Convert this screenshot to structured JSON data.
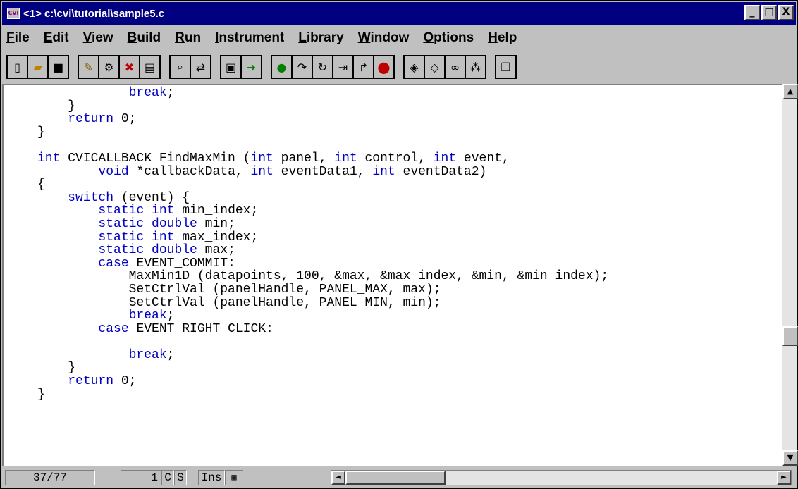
{
  "window": {
    "title": "<1> c:\\cvi\\tutorial\\sample5.c",
    "icon_text": "CVI",
    "minimize": "_",
    "maximize": "□",
    "close": "X"
  },
  "menu": [
    {
      "label": "File",
      "mnemonic": "F",
      "rest": "ile"
    },
    {
      "label": "Edit",
      "mnemonic": "E",
      "rest": "dit"
    },
    {
      "label": "View",
      "mnemonic": "V",
      "rest": "iew"
    },
    {
      "label": "Build",
      "mnemonic": "B",
      "rest": "uild"
    },
    {
      "label": "Run",
      "mnemonic": "R",
      "rest": "un"
    },
    {
      "label": "Instrument",
      "mnemonic": "I",
      "rest": "nstrument"
    },
    {
      "label": "Library",
      "mnemonic": "L",
      "rest": "ibrary"
    },
    {
      "label": "Window",
      "mnemonic": "W",
      "rest": "indow"
    },
    {
      "label": "Options",
      "mnemonic": "O",
      "rest": "ptions"
    },
    {
      "label": "Help",
      "mnemonic": "H",
      "rest": "elp"
    }
  ],
  "toolbar_icons": [
    "new-file-icon",
    "open-file-icon",
    "save-icon",
    "edit-icon",
    "tools-icon",
    "breakpoint-icon",
    "window-icon",
    "find-icon",
    "replace-icon",
    "build-icon",
    "run-icon",
    "go-icon",
    "step-into-icon",
    "step-over-icon",
    "finish-icon",
    "continue-icon",
    "stop-icon",
    "watch-icon",
    "variables-icon",
    "view-icon",
    "trace-icon",
    "copy-icon"
  ],
  "code_lines": [
    [
      {
        "t": "            "
      },
      {
        "t": "break",
        "k": true
      },
      {
        "t": ";"
      }
    ],
    [
      {
        "t": "    }"
      }
    ],
    [
      {
        "t": "    "
      },
      {
        "t": "return",
        "k": true
      },
      {
        "t": " 0;"
      }
    ],
    [
      {
        "t": "}"
      }
    ],
    [
      {
        "t": ""
      }
    ],
    [
      {
        "t": "int",
        "k": true
      },
      {
        "t": " CVICALLBACK FindMaxMin ("
      },
      {
        "t": "int",
        "k": true
      },
      {
        "t": " panel, "
      },
      {
        "t": "int",
        "k": true
      },
      {
        "t": " control, "
      },
      {
        "t": "int",
        "k": true
      },
      {
        "t": " event,"
      }
    ],
    [
      {
        "t": "        "
      },
      {
        "t": "void",
        "k": true
      },
      {
        "t": " *callbackData, "
      },
      {
        "t": "int",
        "k": true
      },
      {
        "t": " eventData1, "
      },
      {
        "t": "int",
        "k": true
      },
      {
        "t": " eventData2)"
      }
    ],
    [
      {
        "t": "{"
      }
    ],
    [
      {
        "t": "    "
      },
      {
        "t": "switch",
        "k": true
      },
      {
        "t": " (event) {"
      }
    ],
    [
      {
        "t": "        "
      },
      {
        "t": "static int",
        "k": true
      },
      {
        "t": " min_index;"
      }
    ],
    [
      {
        "t": "        "
      },
      {
        "t": "static double",
        "k": true
      },
      {
        "t": " min;"
      }
    ],
    [
      {
        "t": "        "
      },
      {
        "t": "static int",
        "k": true
      },
      {
        "t": " max_index;"
      }
    ],
    [
      {
        "t": "        "
      },
      {
        "t": "static double",
        "k": true
      },
      {
        "t": " max;"
      }
    ],
    [
      {
        "t": "        "
      },
      {
        "t": "case",
        "k": true
      },
      {
        "t": " EVENT_COMMIT:"
      }
    ],
    [
      {
        "t": "            MaxMin1D (datapoints, 100, &max, &max_index, &min, &min_index);"
      }
    ],
    [
      {
        "t": "            SetCtrlVal (panelHandle, PANEL_MAX, max);"
      }
    ],
    [
      {
        "t": "            SetCtrlVal (panelHandle, PANEL_MIN, min);"
      }
    ],
    [
      {
        "t": "            "
      },
      {
        "t": "break",
        "k": true
      },
      {
        "t": ";"
      }
    ],
    [
      {
        "t": "        "
      },
      {
        "t": "case",
        "k": true
      },
      {
        "t": " EVENT_RIGHT_CLICK:"
      }
    ],
    [
      {
        "t": ""
      }
    ],
    [
      {
        "t": "            "
      },
      {
        "t": "break",
        "k": true
      },
      {
        "t": ";"
      }
    ],
    [
      {
        "t": "    }"
      }
    ],
    [
      {
        "t": "    "
      },
      {
        "t": "return",
        "k": true
      },
      {
        "t": " 0;"
      }
    ],
    [
      {
        "t": "}"
      }
    ]
  ],
  "scrollbar": {
    "up": "▲",
    "down": "▼",
    "left": "◄",
    "right": "►"
  },
  "status": {
    "line": "37/77",
    "column": "1",
    "c_flag": "C",
    "s_flag": "S",
    "mode": "Ins"
  },
  "colors": {
    "keyword": "#0000c0",
    "titlebar": "#000080"
  }
}
